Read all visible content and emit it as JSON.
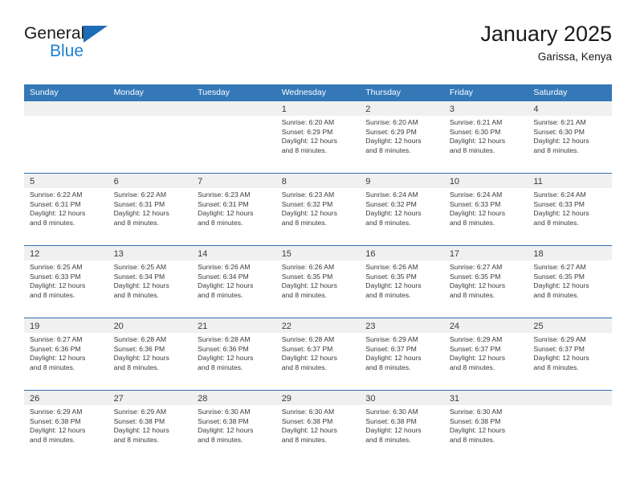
{
  "brand": {
    "word_one": "General",
    "word_two": "Blue",
    "triangle_icon": "blue-triangle-icon"
  },
  "header": {
    "title": "January 2025",
    "subtitle": "Garissa, Kenya"
  },
  "colors": {
    "header_blue": "#3478b8",
    "row_divider_blue": "#2f6fad",
    "day_band_gray": "#f0f0f0",
    "brand_blue": "#1d7fd0",
    "text": "#3a3a3a"
  },
  "calendar": {
    "day_headers": [
      "Sunday",
      "Monday",
      "Tuesday",
      "Wednesday",
      "Thursday",
      "Friday",
      "Saturday"
    ],
    "weeks": [
      [
        {
          "day": "",
          "lines": []
        },
        {
          "day": "",
          "lines": []
        },
        {
          "day": "",
          "lines": []
        },
        {
          "day": "1",
          "lines": [
            "Sunrise: 6:20 AM",
            "Sunset: 6:29 PM",
            "Daylight: 12 hours",
            "and 8 minutes."
          ]
        },
        {
          "day": "2",
          "lines": [
            "Sunrise: 6:20 AM",
            "Sunset: 6:29 PM",
            "Daylight: 12 hours",
            "and 8 minutes."
          ]
        },
        {
          "day": "3",
          "lines": [
            "Sunrise: 6:21 AM",
            "Sunset: 6:30 PM",
            "Daylight: 12 hours",
            "and 8 minutes."
          ]
        },
        {
          "day": "4",
          "lines": [
            "Sunrise: 6:21 AM",
            "Sunset: 6:30 PM",
            "Daylight: 12 hours",
            "and 8 minutes."
          ]
        }
      ],
      [
        {
          "day": "5",
          "lines": [
            "Sunrise: 6:22 AM",
            "Sunset: 6:31 PM",
            "Daylight: 12 hours",
            "and 8 minutes."
          ]
        },
        {
          "day": "6",
          "lines": [
            "Sunrise: 6:22 AM",
            "Sunset: 6:31 PM",
            "Daylight: 12 hours",
            "and 8 minutes."
          ]
        },
        {
          "day": "7",
          "lines": [
            "Sunrise: 6:23 AM",
            "Sunset: 6:31 PM",
            "Daylight: 12 hours",
            "and 8 minutes."
          ]
        },
        {
          "day": "8",
          "lines": [
            "Sunrise: 6:23 AM",
            "Sunset: 6:32 PM",
            "Daylight: 12 hours",
            "and 8 minutes."
          ]
        },
        {
          "day": "9",
          "lines": [
            "Sunrise: 6:24 AM",
            "Sunset: 6:32 PM",
            "Daylight: 12 hours",
            "and 8 minutes."
          ]
        },
        {
          "day": "10",
          "lines": [
            "Sunrise: 6:24 AM",
            "Sunset: 6:33 PM",
            "Daylight: 12 hours",
            "and 8 minutes."
          ]
        },
        {
          "day": "11",
          "lines": [
            "Sunrise: 6:24 AM",
            "Sunset: 6:33 PM",
            "Daylight: 12 hours",
            "and 8 minutes."
          ]
        }
      ],
      [
        {
          "day": "12",
          "lines": [
            "Sunrise: 6:25 AM",
            "Sunset: 6:33 PM",
            "Daylight: 12 hours",
            "and 8 minutes."
          ]
        },
        {
          "day": "13",
          "lines": [
            "Sunrise: 6:25 AM",
            "Sunset: 6:34 PM",
            "Daylight: 12 hours",
            "and 8 minutes."
          ]
        },
        {
          "day": "14",
          "lines": [
            "Sunrise: 6:26 AM",
            "Sunset: 6:34 PM",
            "Daylight: 12 hours",
            "and 8 minutes."
          ]
        },
        {
          "day": "15",
          "lines": [
            "Sunrise: 6:26 AM",
            "Sunset: 6:35 PM",
            "Daylight: 12 hours",
            "and 8 minutes."
          ]
        },
        {
          "day": "16",
          "lines": [
            "Sunrise: 6:26 AM",
            "Sunset: 6:35 PM",
            "Daylight: 12 hours",
            "and 8 minutes."
          ]
        },
        {
          "day": "17",
          "lines": [
            "Sunrise: 6:27 AM",
            "Sunset: 6:35 PM",
            "Daylight: 12 hours",
            "and 8 minutes."
          ]
        },
        {
          "day": "18",
          "lines": [
            "Sunrise: 6:27 AM",
            "Sunset: 6:35 PM",
            "Daylight: 12 hours",
            "and 8 minutes."
          ]
        }
      ],
      [
        {
          "day": "19",
          "lines": [
            "Sunrise: 6:27 AM",
            "Sunset: 6:36 PM",
            "Daylight: 12 hours",
            "and 8 minutes."
          ]
        },
        {
          "day": "20",
          "lines": [
            "Sunrise: 6:28 AM",
            "Sunset: 6:36 PM",
            "Daylight: 12 hours",
            "and 8 minutes."
          ]
        },
        {
          "day": "21",
          "lines": [
            "Sunrise: 6:28 AM",
            "Sunset: 6:36 PM",
            "Daylight: 12 hours",
            "and 8 minutes."
          ]
        },
        {
          "day": "22",
          "lines": [
            "Sunrise: 6:28 AM",
            "Sunset: 6:37 PM",
            "Daylight: 12 hours",
            "and 8 minutes."
          ]
        },
        {
          "day": "23",
          "lines": [
            "Sunrise: 6:29 AM",
            "Sunset: 6:37 PM",
            "Daylight: 12 hours",
            "and 8 minutes."
          ]
        },
        {
          "day": "24",
          "lines": [
            "Sunrise: 6:29 AM",
            "Sunset: 6:37 PM",
            "Daylight: 12 hours",
            "and 8 minutes."
          ]
        },
        {
          "day": "25",
          "lines": [
            "Sunrise: 6:29 AM",
            "Sunset: 6:37 PM",
            "Daylight: 12 hours",
            "and 8 minutes."
          ]
        }
      ],
      [
        {
          "day": "26",
          "lines": [
            "Sunrise: 6:29 AM",
            "Sunset: 6:38 PM",
            "Daylight: 12 hours",
            "and 8 minutes."
          ]
        },
        {
          "day": "27",
          "lines": [
            "Sunrise: 6:29 AM",
            "Sunset: 6:38 PM",
            "Daylight: 12 hours",
            "and 8 minutes."
          ]
        },
        {
          "day": "28",
          "lines": [
            "Sunrise: 6:30 AM",
            "Sunset: 6:38 PM",
            "Daylight: 12 hours",
            "and 8 minutes."
          ]
        },
        {
          "day": "29",
          "lines": [
            "Sunrise: 6:30 AM",
            "Sunset: 6:38 PM",
            "Daylight: 12 hours",
            "and 8 minutes."
          ]
        },
        {
          "day": "30",
          "lines": [
            "Sunrise: 6:30 AM",
            "Sunset: 6:38 PM",
            "Daylight: 12 hours",
            "and 8 minutes."
          ]
        },
        {
          "day": "31",
          "lines": [
            "Sunrise: 6:30 AM",
            "Sunset: 6:38 PM",
            "Daylight: 12 hours",
            "and 8 minutes."
          ]
        },
        {
          "day": "",
          "lines": []
        }
      ]
    ]
  }
}
